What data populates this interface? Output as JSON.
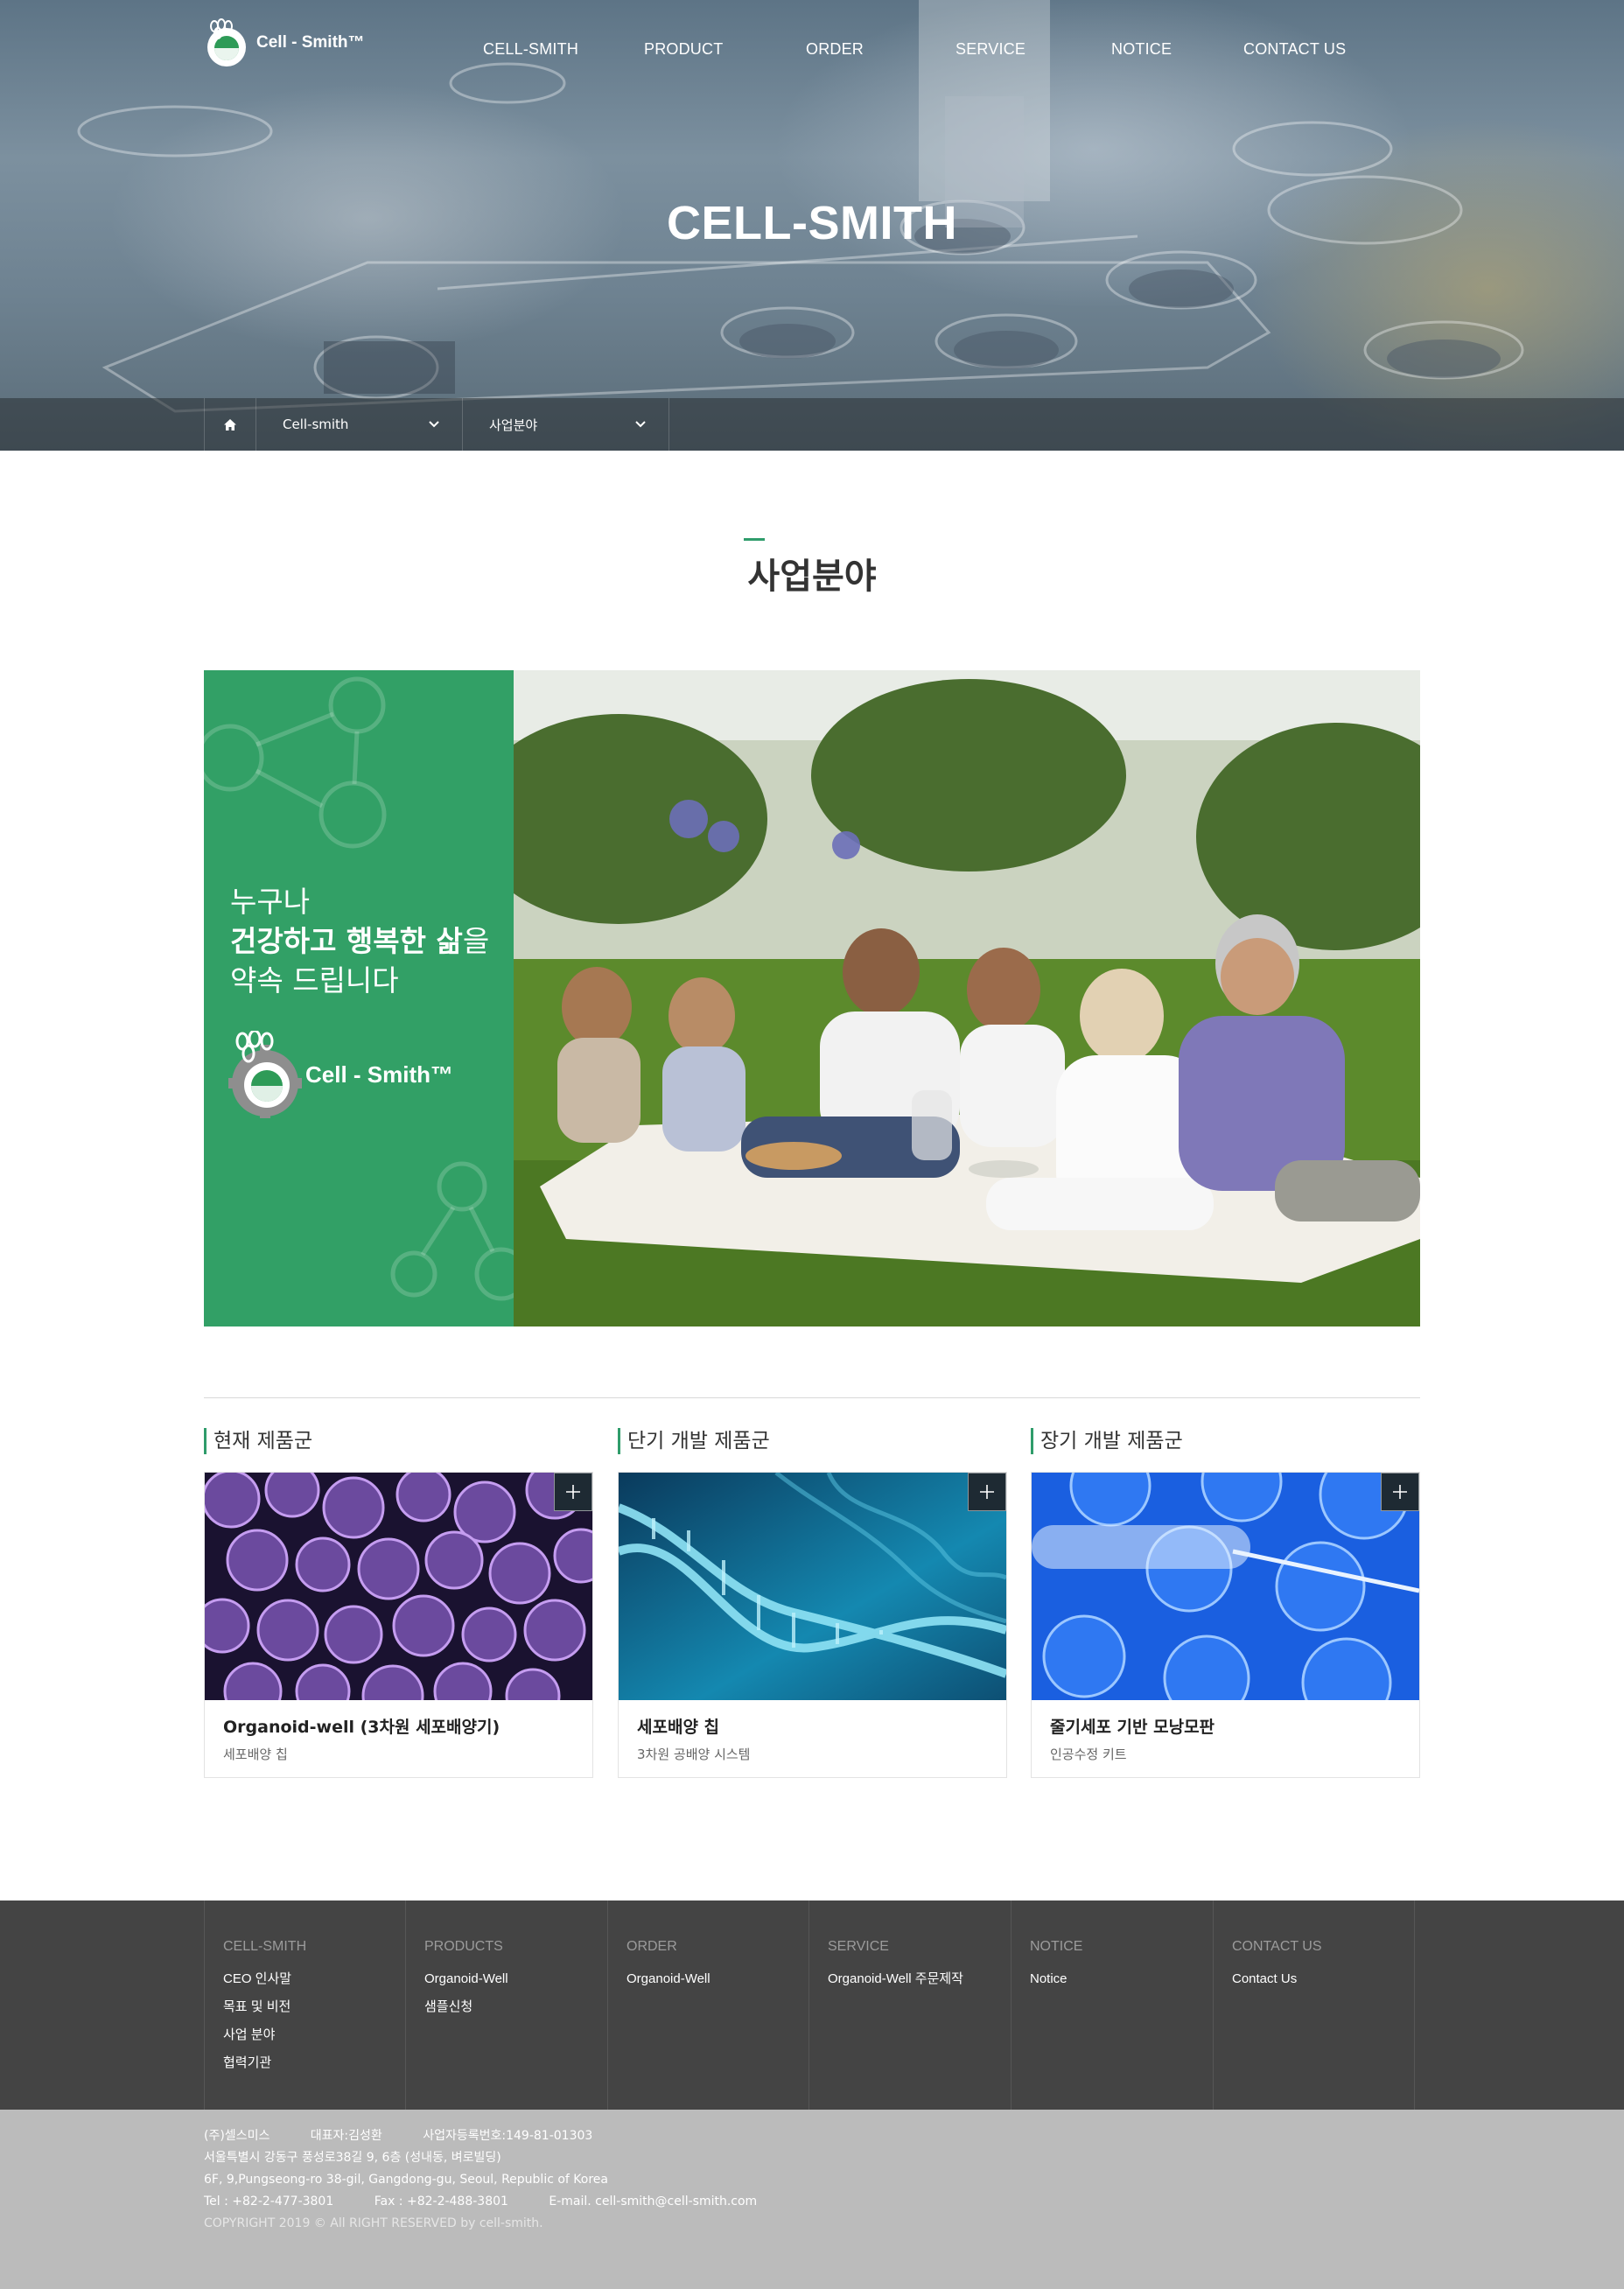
{
  "header": {
    "logo_text": "Cell - Smith™",
    "nav": [
      "CELL-SMITH",
      "PRODUCT",
      "ORDER",
      "SERVICE",
      "NOTICE",
      "CONTACT US"
    ],
    "hero_title": "CELL-SMITH"
  },
  "breadcrumb": {
    "level1": "Cell-smith",
    "level2": "사업분야"
  },
  "page_title": "사업분야",
  "banner": {
    "line1": "누구나",
    "line2_bold": "건강하고 행복한 삶",
    "line2_rest": "을",
    "line3": "약속 드립니다",
    "logo_text": "Cell - Smith™"
  },
  "products": [
    {
      "heading": "현재 제품군",
      "name": "Organoid-well (3차원 세포배양기)",
      "sub": "세포배양 칩"
    },
    {
      "heading": "단기 개발 제품군",
      "name": "세포배양 칩",
      "sub": "3차원 공배양 시스템"
    },
    {
      "heading": "장기 개발 제품군",
      "name": "줄기세포 기반 모낭모판",
      "sub": "인공수정 키트"
    }
  ],
  "footer": {
    "columns": [
      {
        "title": "CELL-SMITH",
        "links": [
          "CEO 인사말",
          "목표 및 비전",
          "사업 분야",
          "협력기관"
        ]
      },
      {
        "title": "PRODUCTS",
        "links": [
          "Organoid-Well",
          "샘플신청"
        ]
      },
      {
        "title": "ORDER",
        "links": [
          "Organoid-Well"
        ]
      },
      {
        "title": "SERVICE",
        "links": [
          "Organoid-Well 주문제작"
        ]
      },
      {
        "title": "NOTICE",
        "links": [
          "Notice"
        ]
      },
      {
        "title": "CONTACT US",
        "links": [
          "Contact Us"
        ]
      }
    ],
    "company": "(주)셀스미스",
    "ceo": "대표자:김성환",
    "biz_no": "사업자등록번호:149-81-01303",
    "address_ko": "서울특별시 강동구 풍성로38길 9, 6층 (성내동, 벼로빌딩)",
    "address_en": "6F, 9,Pungseong-ro 38-gil, Gangdong-gu, Seoul, Republic of Korea",
    "tel": "Tel : +82-2-477-3801",
    "fax": "Fax : +82-2-488-3801",
    "email": "E-mail. cell-smith@cell-smith.com",
    "copyright": "COPYRIGHT 2019 © All RIGHT RESERVED by cell-smith."
  },
  "colors": {
    "brand_green": "#32a066",
    "footer_dark": "#444444",
    "footer_light": "#bbbbbb"
  },
  "icons": [
    "home-icon",
    "chevron-down-icon",
    "plus-icon",
    "cell-smith-logo-icon"
  ]
}
